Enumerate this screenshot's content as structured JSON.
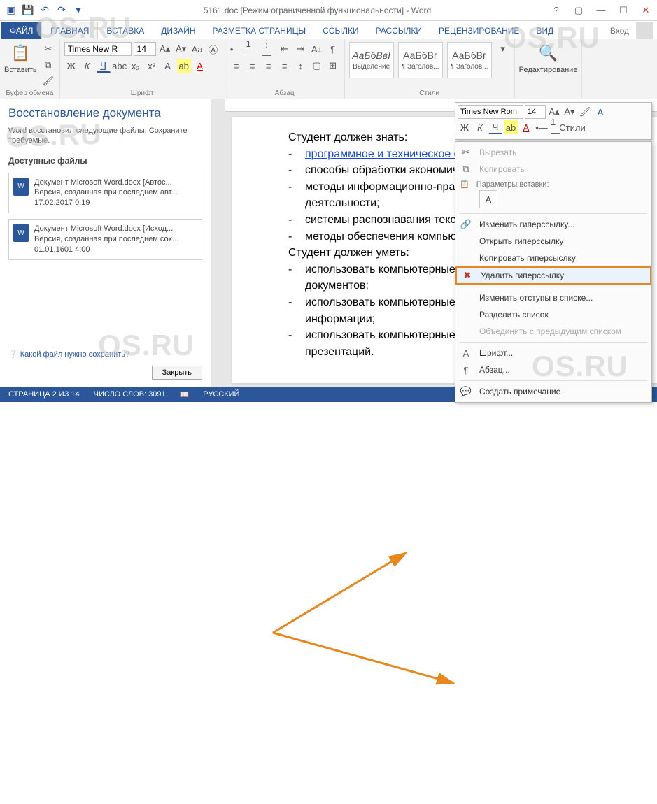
{
  "titlebar": {
    "title": "5161.doc [Режим ограниченной функциональности] - Word"
  },
  "tabs": {
    "file": "ФАЙЛ",
    "home": "ГЛАВНАЯ",
    "insert": "ВСТАВКА",
    "design": "ДИЗАЙН",
    "layout": "РАЗМЕТКА СТРАНИЦЫ",
    "refs": "ССЫЛКИ",
    "mail": "РАССЫЛКИ",
    "review": "РЕЦЕНЗИРОВАНИЕ",
    "view": "ВИД",
    "login": "Вход"
  },
  "ribbon": {
    "clipboard": {
      "label": "Буфер обмена",
      "paste": "Вставить"
    },
    "font": {
      "label": "Шрифт",
      "name": "Times New R",
      "size": "14"
    },
    "para": {
      "label": "Абзац"
    },
    "styles": {
      "label": "Стили",
      "s1": {
        "sample": "АаБбВвІ",
        "name": "Выделение"
      },
      "s2": {
        "sample": "АаБбВг",
        "name": "¶ Заголов..."
      },
      "s3": {
        "sample": "АаБбВг",
        "name": "¶ Заголов..."
      }
    },
    "editing": {
      "label": "Редактирование"
    }
  },
  "panel": {
    "title": "Восстановление документа",
    "desc": "Word восстановил следующие файлы. Сохраните требуемые.",
    "avail": "Доступные файлы",
    "items": [
      {
        "name": "Документ Microsoft Word.docx  [Автос...",
        "ver": "Версия, созданная при последнем авт...",
        "date": "17.02.2017 0:19"
      },
      {
        "name": "Документ Microsoft Word.docx  [Исход...",
        "ver": "Версия, созданная при последнем сох...",
        "date": "01.01.1601 4:00"
      }
    ],
    "help": "Какой файл нужно сохранить?",
    "close": "Закрыть"
  },
  "doc": {
    "l1": "Студент должен знать:",
    "b1": "программное и техническое обеспечение информационных сис",
    "b2": "способы обработки экономиче",
    "b3": "методы информационно-право",
    "b3b": "деятельности;",
    "b4": "системы распознавания текста",
    "b5": "методы обеспечения компьют",
    "l2": "Студент должен уметь:",
    "b6": "использовать компьютерные т",
    "b6b": "документов;",
    "b7": "использовать компьютерные т",
    "b7b": "информации;",
    "b8": "использовать компьютерные те",
    "b8b": "презентаций."
  },
  "mini": {
    "font": "Times New Rom",
    "size": "14",
    "styles_label": "Стили"
  },
  "ctx": {
    "cut": "Вырезать",
    "copy": "Копировать",
    "paste_head": "Параметры вставки:",
    "edit_link": "Изменить гиперссылку...",
    "open_link": "Открыть гиперссылку",
    "copy_link": "Копировать гиперсыслку",
    "remove_link": "Удалить гиперссылку",
    "indent": "Изменить отступы в списке...",
    "split": "Разделить список",
    "merge": "Объединить с предыдущим списком",
    "font": "Шрифт...",
    "para": "Абзац...",
    "comment": "Создать примечание"
  },
  "status": {
    "page": "СТРАНИЦА 2 ИЗ 14",
    "words": "ЧИСЛО СЛОВ: 3091",
    "lang": "РУССКИЙ"
  },
  "watermark": "OS.RU"
}
